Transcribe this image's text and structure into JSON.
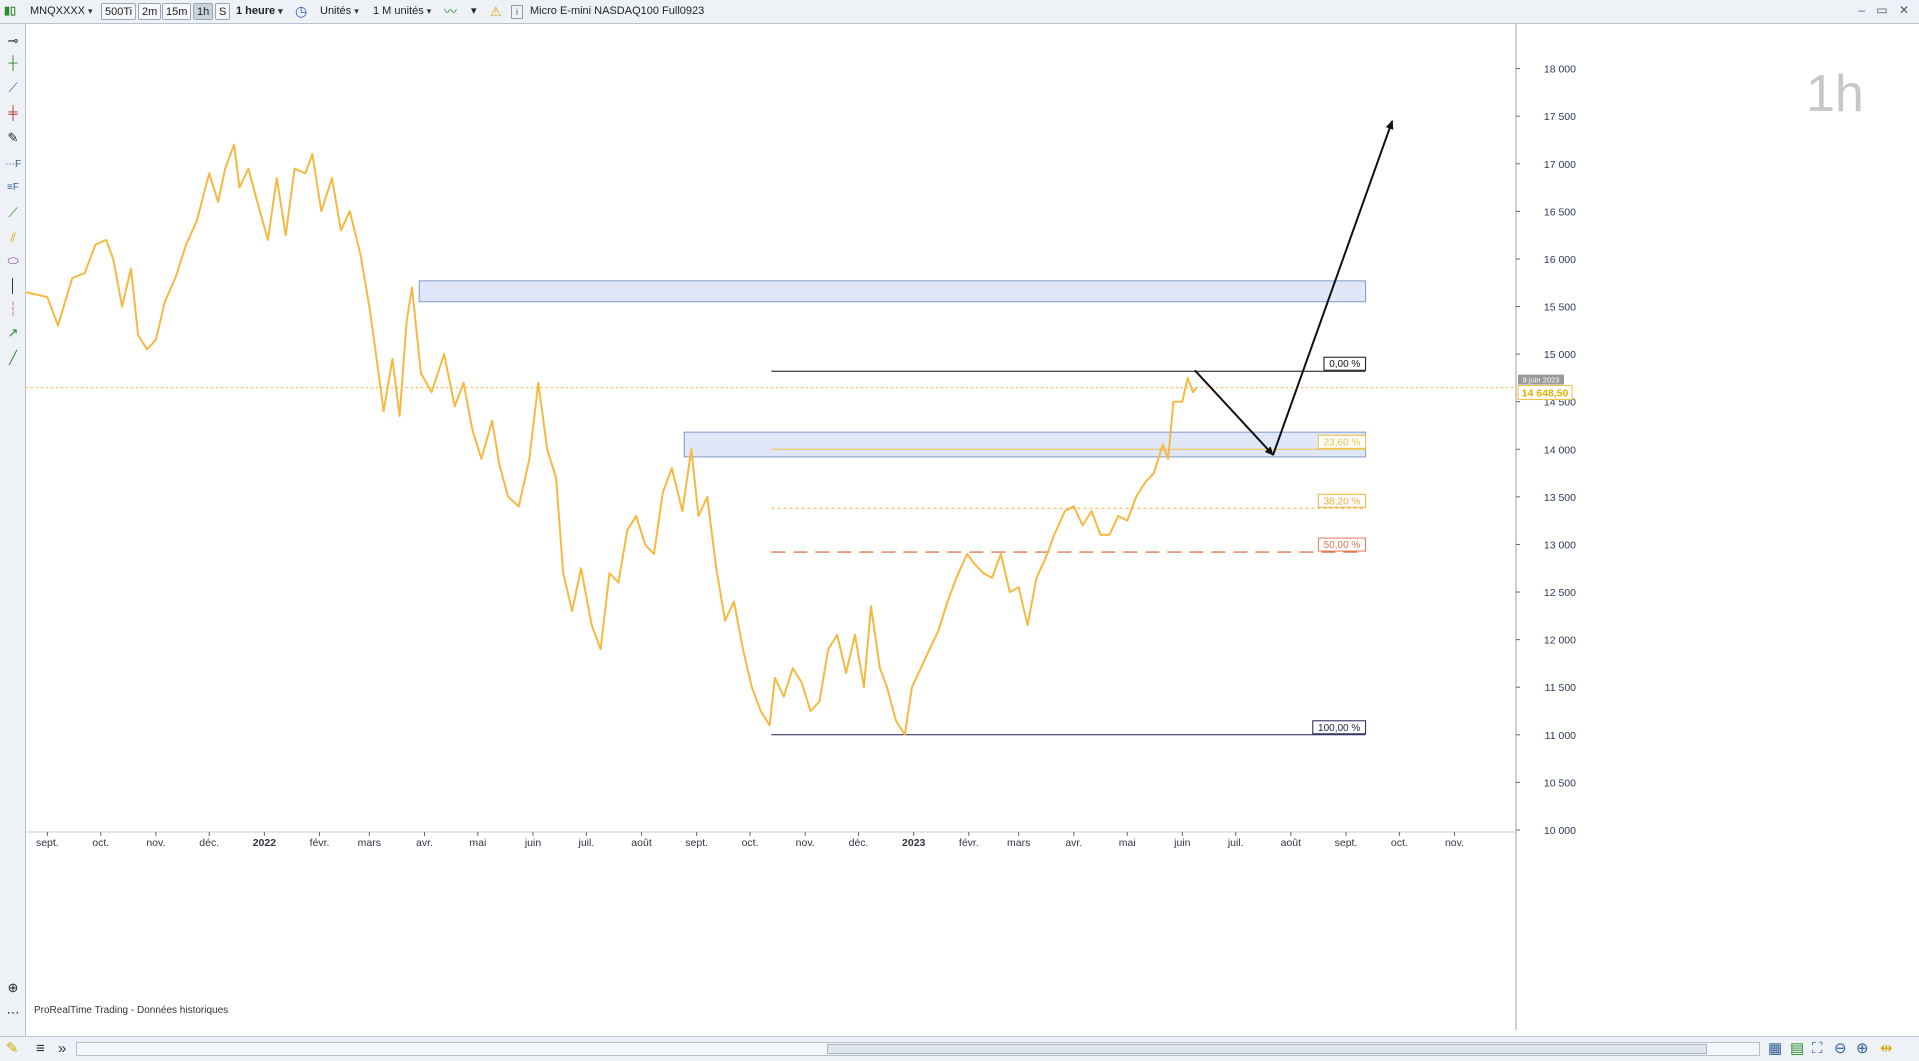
{
  "toolbar": {
    "symbol": "MNQXXXX",
    "timeframes": [
      "500Ti",
      "2m",
      "15m",
      "1h",
      "S"
    ],
    "selected_timeframe": "1h",
    "period": "1 heure",
    "units": "Unités",
    "units_count": "1 M unités",
    "instrument": "Micro E-mini NASDAQ100 Full0923",
    "window_controls": "– ▭ ✕"
  },
  "watermark": "1h",
  "source_note": "ProRealTime Trading - Données historiques",
  "price_label": {
    "date": "9 juin 2023",
    "value": "14 648,50"
  },
  "chart_data": {
    "type": "line",
    "y_ticks": [
      10000,
      10500,
      11000,
      11500,
      12000,
      12500,
      13000,
      13500,
      14000,
      14500,
      15000,
      15500,
      16000,
      16500,
      17000,
      17500,
      18000
    ],
    "y_tick_labels": [
      "10 000",
      "10 500",
      "11 000",
      "11 500",
      "12 000",
      "12 500",
      "13 000",
      "13 500",
      "14 000",
      "14 500",
      "15 000",
      "15 500",
      "16 000",
      "16 500",
      "17 000",
      "17 500",
      "18 000"
    ],
    "y_range": [
      9800,
      18500
    ],
    "x_range": [
      "2021-08-20",
      "2023-12-05"
    ],
    "x_ticks": [
      {
        "date": "2021-09-01",
        "label": "sept.",
        "bold": false
      },
      {
        "date": "2021-10-01",
        "label": "oct.",
        "bold": false
      },
      {
        "date": "2021-11-01",
        "label": "nov.",
        "bold": false
      },
      {
        "date": "2021-12-01",
        "label": "déc.",
        "bold": false
      },
      {
        "date": "2022-01-01",
        "label": "2022",
        "bold": true
      },
      {
        "date": "2022-02-01",
        "label": "févr.",
        "bold": false
      },
      {
        "date": "2022-03-01",
        "label": "mars",
        "bold": false
      },
      {
        "date": "2022-04-01",
        "label": "avr.",
        "bold": false
      },
      {
        "date": "2022-05-01",
        "label": "mai",
        "bold": false
      },
      {
        "date": "2022-06-01",
        "label": "juin",
        "bold": false
      },
      {
        "date": "2022-07-01",
        "label": "juil.",
        "bold": false
      },
      {
        "date": "2022-08-01",
        "label": "août",
        "bold": false
      },
      {
        "date": "2022-09-01",
        "label": "sept.",
        "bold": false
      },
      {
        "date": "2022-10-01",
        "label": "oct.",
        "bold": false
      },
      {
        "date": "2022-11-01",
        "label": "nov.",
        "bold": false
      },
      {
        "date": "2022-12-01",
        "label": "déc.",
        "bold": false
      },
      {
        "date": "2023-01-01",
        "label": "2023",
        "bold": true
      },
      {
        "date": "2023-02-01",
        "label": "févr.",
        "bold": false
      },
      {
        "date": "2023-03-01",
        "label": "mars",
        "bold": false
      },
      {
        "date": "2023-04-01",
        "label": "avr.",
        "bold": false
      },
      {
        "date": "2023-05-01",
        "label": "mai",
        "bold": false
      },
      {
        "date": "2023-06-01",
        "label": "juin",
        "bold": false
      },
      {
        "date": "2023-07-01",
        "label": "juil.",
        "bold": false
      },
      {
        "date": "2023-08-01",
        "label": "août",
        "bold": false
      },
      {
        "date": "2023-09-01",
        "label": "sept.",
        "bold": false
      },
      {
        "date": "2023-10-01",
        "label": "oct.",
        "bold": false
      },
      {
        "date": "2023-11-01",
        "label": "nov.",
        "bold": false
      }
    ],
    "series": [
      {
        "color": "#f5b942",
        "points": [
          [
            "2021-08-20",
            15650
          ],
          [
            "2021-09-01",
            15600
          ],
          [
            "2021-09-07",
            15300
          ],
          [
            "2021-09-15",
            15800
          ],
          [
            "2021-09-22",
            15850
          ],
          [
            "2021-09-28",
            16150
          ],
          [
            "2021-10-04",
            16200
          ],
          [
            "2021-10-08",
            16000
          ],
          [
            "2021-10-13",
            15500
          ],
          [
            "2021-10-18",
            15900
          ],
          [
            "2021-10-22",
            15200
          ],
          [
            "2021-10-27",
            15050
          ],
          [
            "2021-11-01",
            15150
          ],
          [
            "2021-11-06",
            15550
          ],
          [
            "2021-11-12",
            15800
          ],
          [
            "2021-11-18",
            16150
          ],
          [
            "2021-11-24",
            16400
          ],
          [
            "2021-12-01",
            16900
          ],
          [
            "2021-12-06",
            16600
          ],
          [
            "2021-12-10",
            16950
          ],
          [
            "2021-12-15",
            17200
          ],
          [
            "2021-12-18",
            16750
          ],
          [
            "2021-12-23",
            16950
          ],
          [
            "2021-12-28",
            16600
          ],
          [
            "2022-01-03",
            16200
          ],
          [
            "2022-01-08",
            16850
          ],
          [
            "2022-01-13",
            16250
          ],
          [
            "2022-01-18",
            16950
          ],
          [
            "2022-01-24",
            16900
          ],
          [
            "2022-01-28",
            17100
          ],
          [
            "2022-02-02",
            16500
          ],
          [
            "2022-02-08",
            16850
          ],
          [
            "2022-02-13",
            16300
          ],
          [
            "2022-02-18",
            16500
          ],
          [
            "2022-02-24",
            16050
          ],
          [
            "2022-03-01",
            15500
          ],
          [
            "2022-03-04",
            15100
          ],
          [
            "2022-03-09",
            14400
          ],
          [
            "2022-03-14",
            14950
          ],
          [
            "2022-03-18",
            14350
          ],
          [
            "2022-03-22",
            15350
          ],
          [
            "2022-03-25",
            15700
          ],
          [
            "2022-03-30",
            14800
          ],
          [
            "2022-04-05",
            14600
          ],
          [
            "2022-04-12",
            15000
          ],
          [
            "2022-04-18",
            14450
          ],
          [
            "2022-04-23",
            14700
          ],
          [
            "2022-04-28",
            14200
          ],
          [
            "2022-05-03",
            13900
          ],
          [
            "2022-05-09",
            14300
          ],
          [
            "2022-05-13",
            13850
          ],
          [
            "2022-05-18",
            13500
          ],
          [
            "2022-05-24",
            13400
          ],
          [
            "2022-05-30",
            13900
          ],
          [
            "2022-06-04",
            14700
          ],
          [
            "2022-06-09",
            14000
          ],
          [
            "2022-06-14",
            13700
          ],
          [
            "2022-06-18",
            12700
          ],
          [
            "2022-06-23",
            12300
          ],
          [
            "2022-06-28",
            12750
          ],
          [
            "2022-07-04",
            12150
          ],
          [
            "2022-07-09",
            11900
          ],
          [
            "2022-07-14",
            12700
          ],
          [
            "2022-07-19",
            12600
          ],
          [
            "2022-07-24",
            13150
          ],
          [
            "2022-07-29",
            13300
          ],
          [
            "2022-08-03",
            13000
          ],
          [
            "2022-08-08",
            12900
          ],
          [
            "2022-08-13",
            13550
          ],
          [
            "2022-08-18",
            13800
          ],
          [
            "2022-08-24",
            13350
          ],
          [
            "2022-08-29",
            14000
          ],
          [
            "2022-09-02",
            13300
          ],
          [
            "2022-09-07",
            13500
          ],
          [
            "2022-09-12",
            12750
          ],
          [
            "2022-09-17",
            12200
          ],
          [
            "2022-09-22",
            12400
          ],
          [
            "2022-09-27",
            11900
          ],
          [
            "2022-10-02",
            11500
          ],
          [
            "2022-10-07",
            11250
          ],
          [
            "2022-10-12",
            11100
          ],
          [
            "2022-10-15",
            11600
          ],
          [
            "2022-10-20",
            11400
          ],
          [
            "2022-10-25",
            11700
          ],
          [
            "2022-10-30",
            11550
          ],
          [
            "2022-11-04",
            11250
          ],
          [
            "2022-11-09",
            11350
          ],
          [
            "2022-11-14",
            11900
          ],
          [
            "2022-11-19",
            12050
          ],
          [
            "2022-11-24",
            11650
          ],
          [
            "2022-11-29",
            12050
          ],
          [
            "2022-12-04",
            11500
          ],
          [
            "2022-12-08",
            12350
          ],
          [
            "2022-12-13",
            11700
          ],
          [
            "2022-12-17",
            11500
          ],
          [
            "2022-12-22",
            11150
          ],
          [
            "2022-12-27",
            11000
          ],
          [
            "2022-12-31",
            11500
          ],
          [
            "2023-01-05",
            11700
          ],
          [
            "2023-01-10",
            11900
          ],
          [
            "2023-01-15",
            12100
          ],
          [
            "2023-01-20",
            12400
          ],
          [
            "2023-01-25",
            12650
          ],
          [
            "2023-01-31",
            12900
          ],
          [
            "2023-02-04",
            12800
          ],
          [
            "2023-02-09",
            12700
          ],
          [
            "2023-02-14",
            12650
          ],
          [
            "2023-02-19",
            12900
          ],
          [
            "2023-02-24",
            12500
          ],
          [
            "2023-03-01",
            12550
          ],
          [
            "2023-03-06",
            12150
          ],
          [
            "2023-03-11",
            12650
          ],
          [
            "2023-03-16",
            12850
          ],
          [
            "2023-03-21",
            13100
          ],
          [
            "2023-03-27",
            13350
          ],
          [
            "2023-04-01",
            13400
          ],
          [
            "2023-04-06",
            13200
          ],
          [
            "2023-04-11",
            13350
          ],
          [
            "2023-04-16",
            13100
          ],
          [
            "2023-04-21",
            13100
          ],
          [
            "2023-04-26",
            13300
          ],
          [
            "2023-05-01",
            13250
          ],
          [
            "2023-05-06",
            13500
          ],
          [
            "2023-05-11",
            13650
          ],
          [
            "2023-05-16",
            13750
          ],
          [
            "2023-05-21",
            14050
          ],
          [
            "2023-05-24",
            13900
          ],
          [
            "2023-05-27",
            14500
          ],
          [
            "2023-06-01",
            14500
          ],
          [
            "2023-06-04",
            14750
          ],
          [
            "2023-06-07",
            14600
          ],
          [
            "2023-06-09",
            14650
          ]
        ]
      }
    ],
    "annotations": {
      "resistance_zone": {
        "x1": "2022-03-29",
        "x2": "2023-09-12",
        "y1": 15550,
        "y2": 15770
      },
      "support_zone": {
        "x1": "2022-08-25",
        "x2": "2023-09-12",
        "y1": 13920,
        "y2": 14180
      },
      "current_price": 14648.5,
      "fibonacci": {
        "x1": "2022-10-13",
        "x2": "2023-09-12",
        "levels": [
          {
            "label": "0,00 %",
            "value": 14820,
            "color": "#111111",
            "dash": ""
          },
          {
            "label": "23,60 %",
            "value": 14000,
            "color": "#f0c040",
            "dash": ""
          },
          {
            "label": "38,20 %",
            "value": 13380,
            "color": "#f0b040",
            "dash": "3,3"
          },
          {
            "label": "50,00 %",
            "value": 12920,
            "color": "#e07a50",
            "dash": "14,8"
          },
          {
            "label": "100,00 %",
            "value": 11000,
            "color": "#222255",
            "dash": ""
          }
        ]
      },
      "projection_arrows": [
        {
          "from": [
            "2023-06-08",
            14830
          ],
          "to": [
            "2023-07-22",
            13940
          ]
        },
        {
          "from": [
            "2023-07-22",
            13940
          ],
          "to": [
            "2023-09-27",
            17450
          ]
        }
      ]
    }
  }
}
